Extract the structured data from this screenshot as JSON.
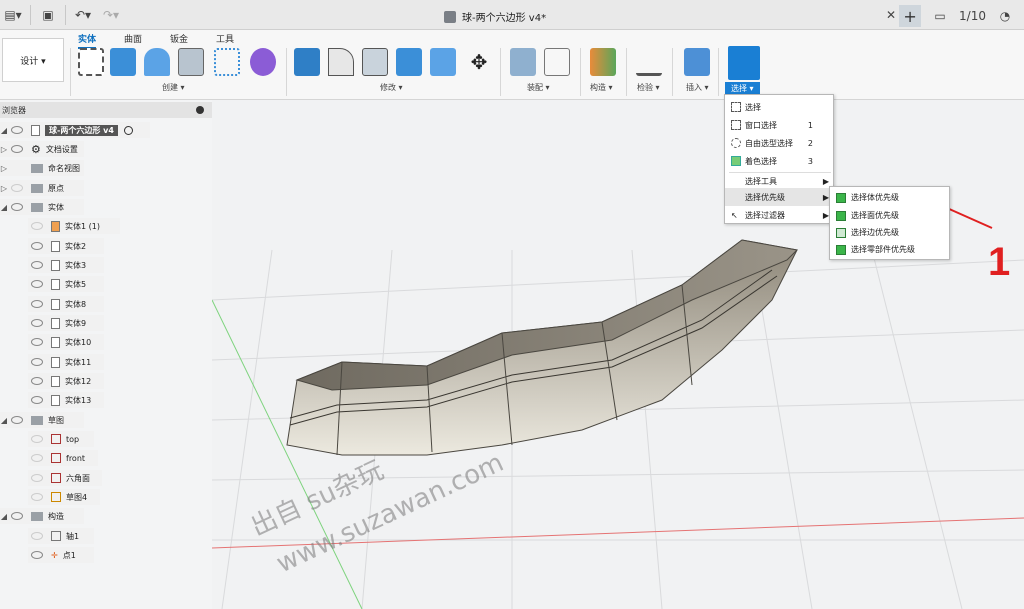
{
  "title": "球-两个六边形 v4*",
  "toolbar": {
    "design_label": "设计 ▾",
    "tabs": [
      "实体",
      "曲面",
      "钣金",
      "工具"
    ],
    "groups": {
      "create": "创建 ▾",
      "modify": "修改 ▾",
      "assemble": "装配 ▾",
      "construct": "构造 ▾",
      "inspect": "检验 ▾",
      "insert": "插入 ▾",
      "select": "选择 ▾"
    }
  },
  "topright": {
    "counter": "1/10"
  },
  "browser": {
    "header": "浏览器",
    "root": "球-两个六边形 v4",
    "items": [
      {
        "label": "文档设置",
        "type": "gear"
      },
      {
        "label": "命名视图",
        "type": "folder"
      },
      {
        "label": "原点",
        "type": "folder"
      },
      {
        "label": "实体",
        "type": "folder"
      },
      {
        "label": "实体1 (1)",
        "type": "body"
      },
      {
        "label": "实体2",
        "type": "body"
      },
      {
        "label": "实体3",
        "type": "body"
      },
      {
        "label": "实体5",
        "type": "body"
      },
      {
        "label": "实体8",
        "type": "body"
      },
      {
        "label": "实体9",
        "type": "body"
      },
      {
        "label": "实体10",
        "type": "body"
      },
      {
        "label": "实体11",
        "type": "body"
      },
      {
        "label": "实体12",
        "type": "body"
      },
      {
        "label": "实体13",
        "type": "body"
      },
      {
        "label": "草图",
        "type": "folder"
      },
      {
        "label": "top",
        "type": "sketch"
      },
      {
        "label": "front",
        "type": "sketch"
      },
      {
        "label": "六角面",
        "type": "sketch"
      },
      {
        "label": "草图4",
        "type": "sketch"
      },
      {
        "label": "构造",
        "type": "folder"
      },
      {
        "label": "轴1",
        "type": "axis"
      },
      {
        "label": "点1",
        "type": "point"
      }
    ]
  },
  "menu": {
    "items": [
      {
        "label": "选择",
        "key": ""
      },
      {
        "label": "窗口选择",
        "key": "1"
      },
      {
        "label": "自由选型选择",
        "key": "2"
      },
      {
        "label": "着色选择",
        "key": "3"
      },
      {
        "label": "选择工具",
        "key": ""
      },
      {
        "label": "选择优先级",
        "key": ""
      },
      {
        "label": "选择过滤器",
        "key": ""
      }
    ],
    "submenu": [
      "选择体优先级",
      "选择面优先级",
      "选择边优先级",
      "选择零部件优先级"
    ]
  },
  "annotation": {
    "number": "1"
  },
  "watermark": {
    "line1": "出自 su杂玩",
    "line2": "www.suzawan.com"
  }
}
